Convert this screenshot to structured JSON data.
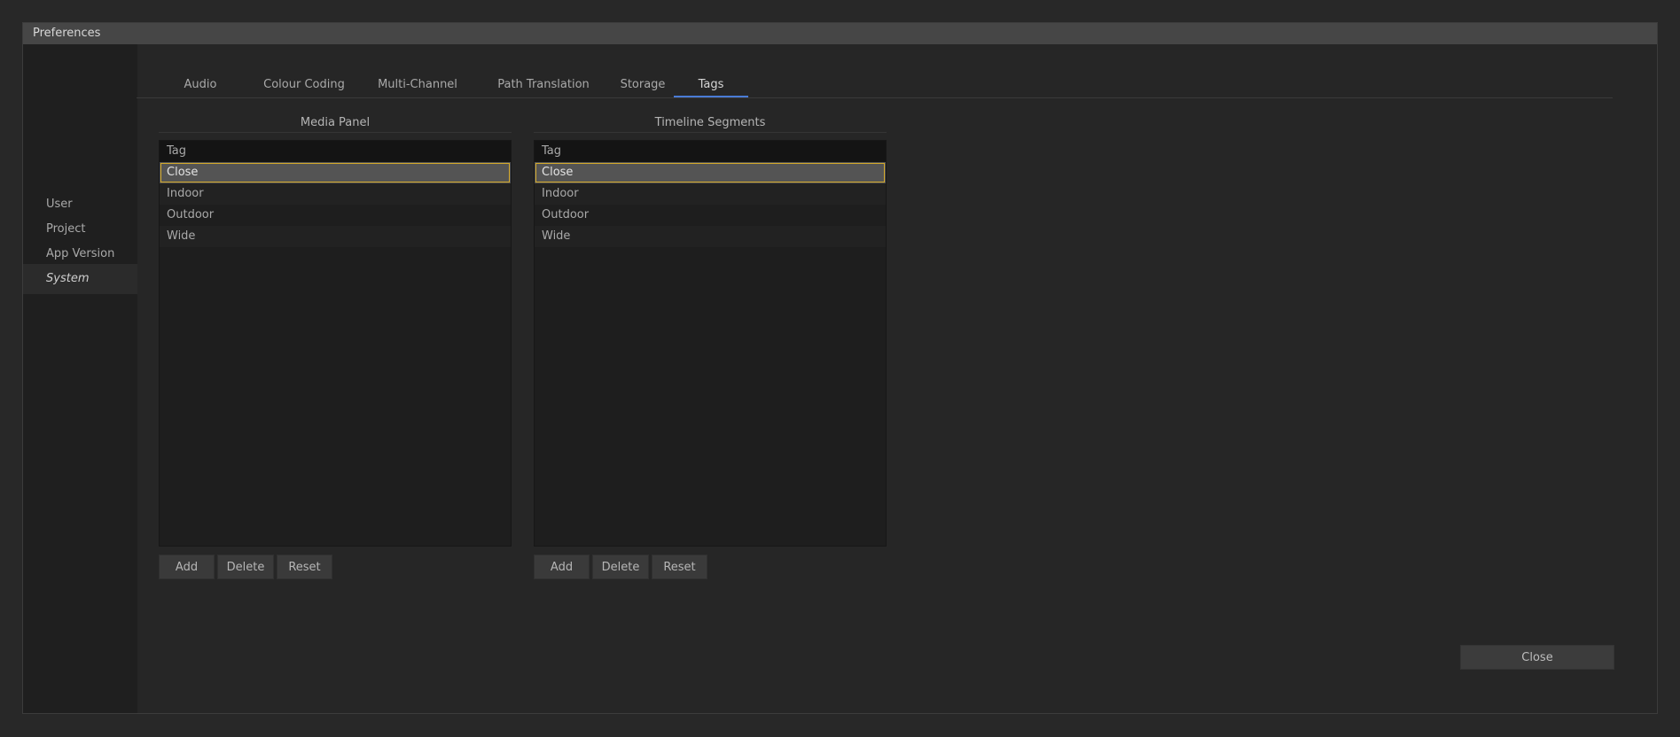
{
  "window": {
    "title": "Preferences"
  },
  "sidebar": {
    "items": [
      {
        "label": "User"
      },
      {
        "label": "Project"
      },
      {
        "label": "App Version"
      },
      {
        "label": "System"
      }
    ],
    "active": "System"
  },
  "tabs": {
    "items": [
      {
        "label": "Audio"
      },
      {
        "label": "Colour Coding"
      },
      {
        "label": "Multi-Channel"
      },
      {
        "label": "Path Translation"
      },
      {
        "label": "Storage"
      },
      {
        "label": "Tags"
      }
    ],
    "active": "Tags",
    "accent_color": "#4a7bd6"
  },
  "media_panel": {
    "title": "Media Panel",
    "column_header": "Tag",
    "rows": [
      "Close",
      "Indoor",
      "Outdoor",
      "Wide"
    ],
    "selected": "Close",
    "buttons": {
      "add": "Add",
      "delete": "Delete",
      "reset": "Reset"
    }
  },
  "timeline_segments": {
    "title": "Timeline Segments",
    "column_header": "Tag",
    "rows": [
      "Close",
      "Indoor",
      "Outdoor",
      "Wide"
    ],
    "selected": "Close",
    "buttons": {
      "add": "Add",
      "delete": "Delete",
      "reset": "Reset"
    }
  },
  "footer": {
    "close_label": "Close"
  },
  "colors": {
    "selection_border": "#d4a92a"
  }
}
